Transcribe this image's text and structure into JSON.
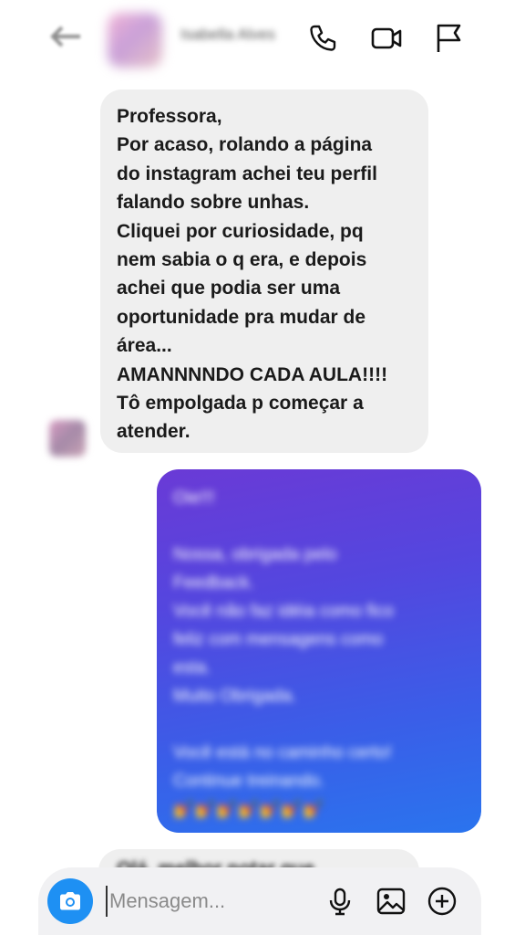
{
  "header": {
    "contact_name": "Isabella Alves",
    "icons": [
      "back-arrow-icon",
      "phone-icon",
      "video-icon",
      "flag-icon"
    ]
  },
  "incoming_message": {
    "lines": [
      "Professora,",
      "Por acaso, rolando a página",
      "do instagram achei teu perfil",
      "falando sobre unhas.",
      "Cliquei por curiosidade, pq",
      "nem sabia o q era, e depois",
      "achei que podia ser uma",
      "oportunidade pra mudar de",
      "área...",
      "AMANNNNDO CADA AULA!!!!",
      "Tô empolgada p começar a",
      "atender."
    ]
  },
  "outgoing_message": {
    "blurred": true,
    "lines": [
      "Oie!!!",
      "",
      "Nossa, obrigada pelo",
      "Feedback.",
      "Você não faz idéia como fico",
      "feliz com mensagens como",
      "esta.",
      "Muito Obrigada.",
      "",
      "Você está no caminho certo!",
      "Continue treinando.",
      "💅💅💅💅💅💅💅"
    ],
    "gradient": [
      "#6a3ad6",
      "#2a74ee"
    ]
  },
  "next_message_peek": {
    "text": "Olá, melhor notar que"
  },
  "composer": {
    "placeholder": "Mensagem...",
    "value": "",
    "camera_color": "#1e90f3"
  },
  "colors": {
    "incoming_bubble": "#efefef",
    "composer_bg": "#f1f1f3"
  }
}
